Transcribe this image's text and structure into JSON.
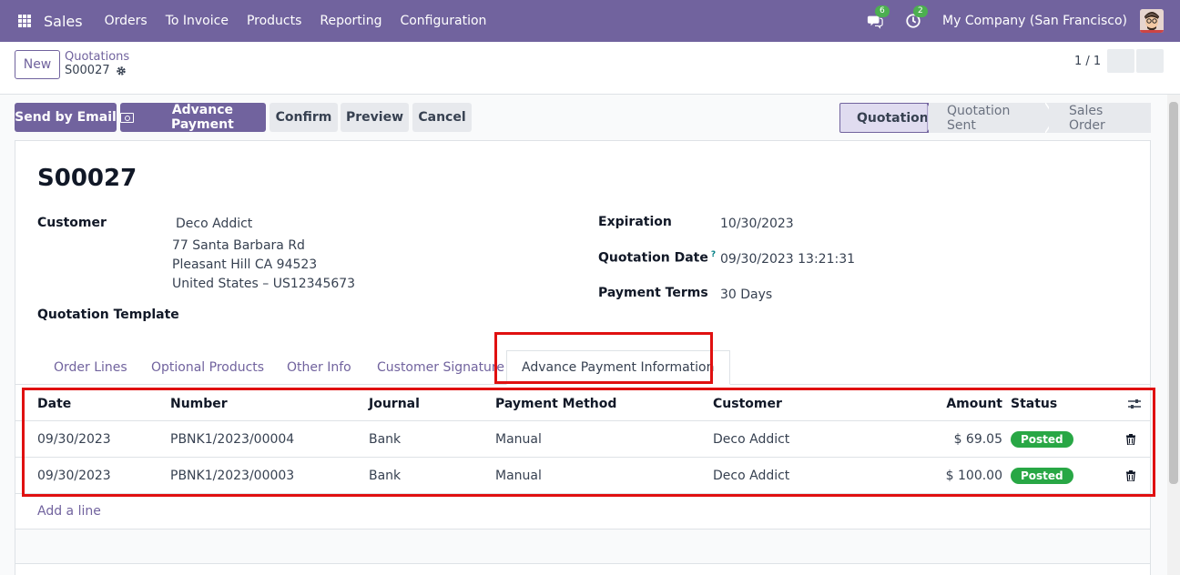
{
  "navbar": {
    "app_name": "Sales",
    "menu": [
      "Orders",
      "To Invoice",
      "Products",
      "Reporting",
      "Configuration"
    ],
    "messages_badge": "6",
    "activities_badge": "2",
    "company": "My Company (San Francisco)"
  },
  "control_panel": {
    "new_label": "New",
    "breadcrumb_parent": "Quotations",
    "breadcrumb_current": "S00027",
    "pager": "1 / 1"
  },
  "actions": {
    "send_by_email": "Send by Email",
    "advance_payment": "Advance Payment",
    "confirm": "Confirm",
    "preview": "Preview",
    "cancel": "Cancel"
  },
  "statusbar": {
    "stages": [
      "Quotation",
      "Quotation Sent",
      "Sales Order"
    ],
    "active": "Quotation"
  },
  "form": {
    "title": "S00027",
    "customer_label": "Customer",
    "customer_name": "Deco Addict",
    "address_line1": "77 Santa Barbara Rd",
    "address_line2": "Pleasant Hill CA 94523",
    "address_line3": "United States – US12345673",
    "quotation_template_label": "Quotation Template",
    "expiration_label": "Expiration",
    "expiration_value": "10/30/2023",
    "quotation_date_label": "Quotation Date",
    "quotation_date_help": "?",
    "quotation_date_value": "09/30/2023 13:21:31",
    "payment_terms_label": "Payment Terms",
    "payment_terms_value": "30 Days"
  },
  "tabs": [
    "Order Lines",
    "Optional Products",
    "Other Info",
    "Customer Signature",
    "Advance Payment Information"
  ],
  "payments_table": {
    "headers": [
      "Date",
      "Number",
      "Journal",
      "Payment Method",
      "Customer",
      "Amount",
      "Status"
    ],
    "rows": [
      {
        "date": "09/30/2023",
        "number": "PBNK1/2023/00004",
        "journal": "Bank",
        "method": "Manual",
        "customer": "Deco Addict",
        "amount": "$ 69.05",
        "status": "Posted"
      },
      {
        "date": "09/30/2023",
        "number": "PBNK1/2023/00003",
        "journal": "Bank",
        "method": "Manual",
        "customer": "Deco Addict",
        "amount": "$ 100.00",
        "status": "Posted"
      }
    ],
    "add_line": "Add a line"
  },
  "colors": {
    "brand": "#71639e",
    "posted": "#28a745",
    "highlight": "#e01010"
  }
}
